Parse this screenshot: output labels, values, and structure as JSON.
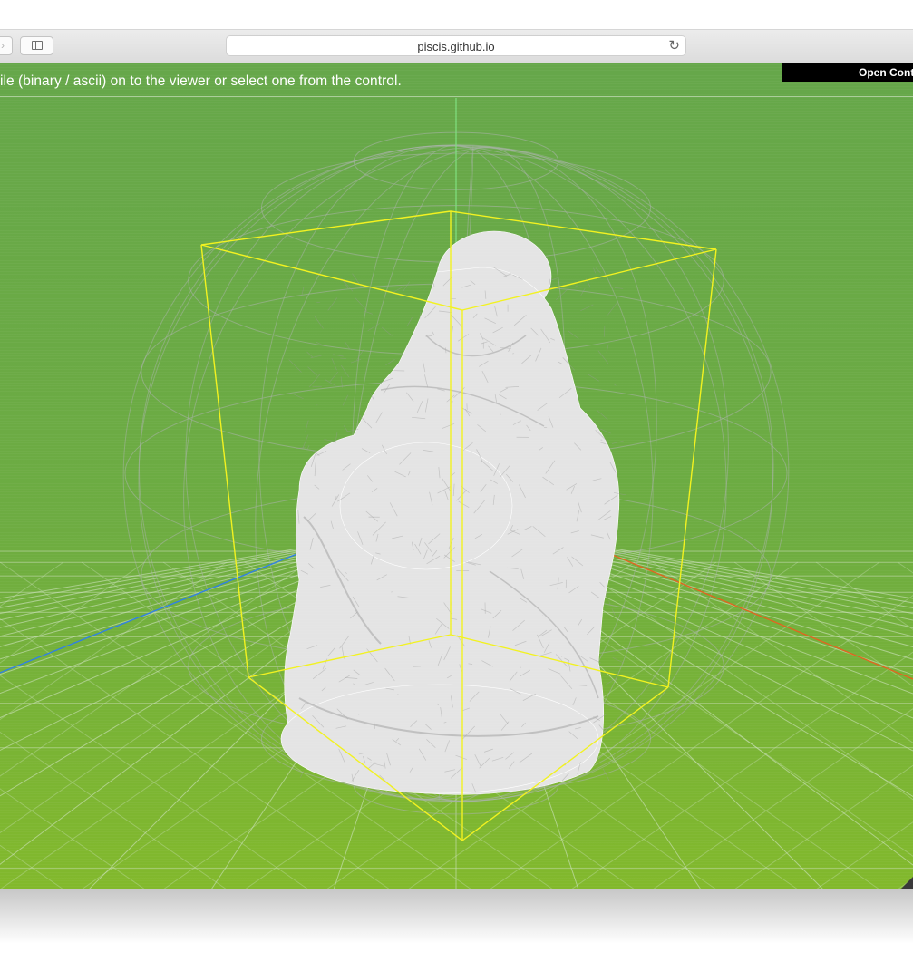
{
  "browser": {
    "address": "piscis.github.io",
    "forward_glyph": "›",
    "reload_glyph": "↻"
  },
  "viewer": {
    "instructions": "ile (binary / ascii) on to the viewer or select one from the control.",
    "controls_label": "Open Contr",
    "colors": {
      "background_top": "#66a74a",
      "background_bottom": "#82b92c",
      "grid": "#cfe2c0",
      "bounding_box": "#f2f21e",
      "bounding_sphere": "#a9b3a9",
      "model": "#e4e4e4",
      "axis_x": "#e0641e",
      "axis_y": "#7ee07e",
      "axis_z": "#2e7fe6"
    }
  }
}
